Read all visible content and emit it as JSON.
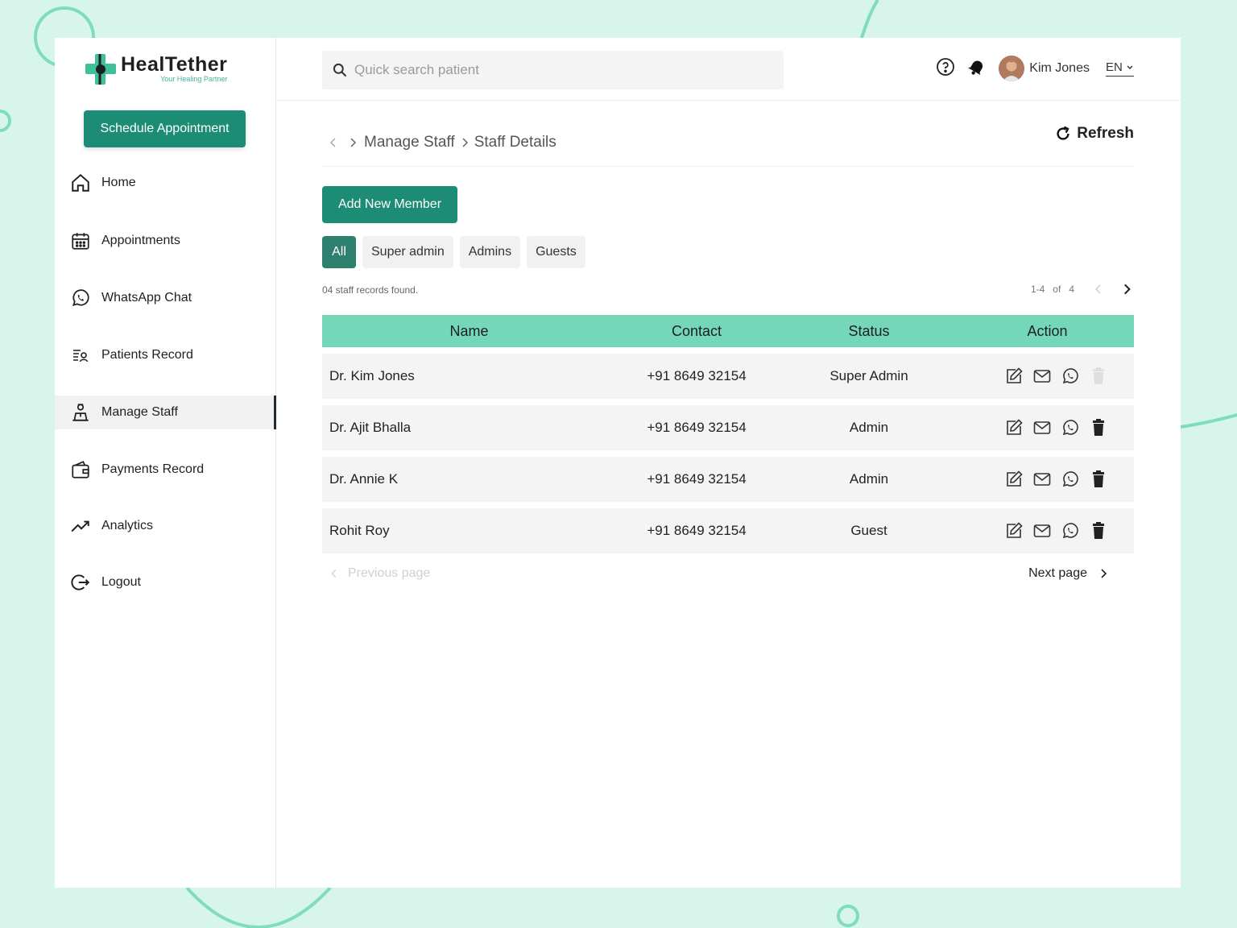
{
  "brand": {
    "name": "HealTether",
    "tagline": "Your Healing Partner"
  },
  "sidebar": {
    "schedule_label": "Schedule Appointment",
    "items": [
      {
        "label": "Home",
        "icon": "home-icon"
      },
      {
        "label": "Appointments",
        "icon": "calendar-icon"
      },
      {
        "label": "WhatsApp Chat",
        "icon": "whatsapp-icon"
      },
      {
        "label": "Patients Record",
        "icon": "patients-record-icon"
      },
      {
        "label": "Manage Staff",
        "icon": "staff-icon",
        "active": true
      },
      {
        "label": "Payments Record",
        "icon": "wallet-icon"
      },
      {
        "label": "Analytics",
        "icon": "trend-icon"
      },
      {
        "label": "Logout",
        "icon": "logout-icon"
      }
    ]
  },
  "topbar": {
    "search_placeholder": "Quick search patient",
    "user_name": "Kim Jones",
    "language": "EN"
  },
  "breadcrumb": {
    "items": [
      "Manage Staff",
      "Staff Details"
    ],
    "refresh_label": "Refresh"
  },
  "content": {
    "add_label": "Add New Member",
    "filters": [
      "All",
      "Super admin",
      "Admins",
      "Guests"
    ],
    "records_text": "04 staff records found.",
    "pager": {
      "range": "1-4",
      "of": "of",
      "total": "4"
    },
    "table": {
      "headers": [
        "Name",
        "Contact",
        "Status",
        "Action"
      ],
      "rows": [
        {
          "name": "Dr. Kim Jones",
          "contact": "+91 8649 32154",
          "status": "Super Admin",
          "delete_disabled": true
        },
        {
          "name": "Dr. Ajit Bhalla",
          "contact": "+91 8649 32154",
          "status": "Admin",
          "delete_disabled": false
        },
        {
          "name": "Dr. Annie K",
          "contact": "+91 8649 32154",
          "status": "Admin",
          "delete_disabled": false
        },
        {
          "name": "Rohit Roy",
          "contact": "+91 8649 32154",
          "status": "Guest",
          "delete_disabled": false
        }
      ]
    },
    "prev_label": "Previous page",
    "next_label": "Next page"
  },
  "colors": {
    "accent": "#1d8c74",
    "table_header": "#74d7b8",
    "background": "#d8f5ec"
  }
}
